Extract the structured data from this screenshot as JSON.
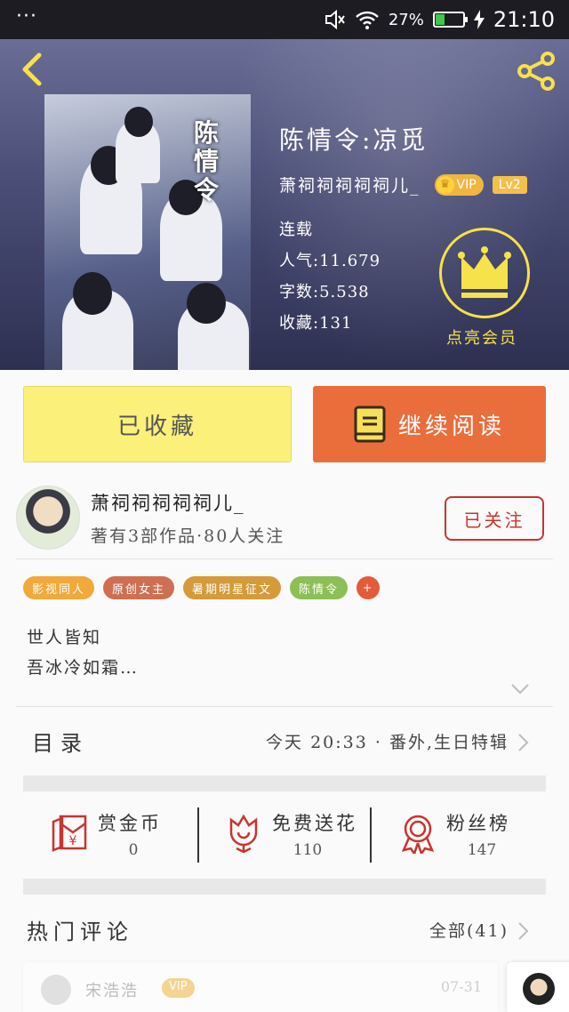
{
  "status_bar": {
    "dots": "···",
    "battery": "27%",
    "time": "21:10"
  },
  "book": {
    "title": "陈情令:凉觅",
    "author": "萧祠祠祠祠祠儿_",
    "vip": "VIP",
    "level": "Lv2",
    "status": "连载",
    "popularity": "人气:11.679",
    "words": "字数:5.538",
    "favorites": "收藏:131",
    "cover_art_text": "陈情令",
    "member_label": "点亮会员"
  },
  "actions": {
    "collected": "已收藏",
    "continue_reading": "继续阅读"
  },
  "author_card": {
    "name": "萧祠祠祠祠祠儿_",
    "sub": "著有3部作品·80人关注",
    "follow": "已关注"
  },
  "tags": [
    {
      "label": "影视同人",
      "color": "#f0a93a"
    },
    {
      "label": "原创女主",
      "color": "#cf6f52"
    },
    {
      "label": "暑期明星征文",
      "color": "#d59a3a"
    },
    {
      "label": "陈情令",
      "color": "#8cbf55"
    },
    {
      "label": "+",
      "color": "#e55a3a"
    }
  ],
  "synopsis": {
    "line1": "世人皆知",
    "line2": "吾冰冷如霜…"
  },
  "toc": {
    "label": "目录",
    "latest": "今天 20:33 · 番外,生日特辑"
  },
  "stats": [
    {
      "label": "赏金币",
      "value": "0"
    },
    {
      "label": "免费送花",
      "value": "110"
    },
    {
      "label": "粉丝榜",
      "value": "147"
    }
  ],
  "comments": {
    "label": "热门评论",
    "all": "全部(41)",
    "first": {
      "name": "宋浩浩",
      "vip": "VIP",
      "date": "07-31"
    }
  }
}
